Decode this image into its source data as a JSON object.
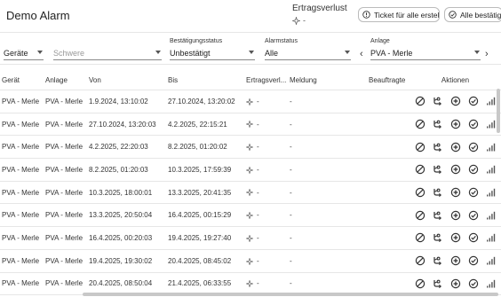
{
  "header": {
    "title": "Demo Alarm",
    "ertragsverlust_label": "Ertragsverlust",
    "ertragsverlust_value": "-",
    "ticket_button": "Ticket für alle erstellen",
    "confirm_all_button": "Alle bestätigen"
  },
  "filters": {
    "geraete": {
      "value": "Geräte"
    },
    "schwere": {
      "placeholder": "Schwere"
    },
    "bestaetigungsstatus": {
      "label": "Bestätigungsstatus",
      "value": "Unbestätigt"
    },
    "alarmstatus": {
      "label": "Alarmstatus",
      "value": "Alle"
    },
    "anlage": {
      "label": "Anlage",
      "value": "PVA - Merle",
      "prev": "‹",
      "next": "›"
    }
  },
  "table": {
    "columns": {
      "geraet": "Gerät",
      "anlage": "Anlage",
      "von": "Von",
      "bis": "Bis",
      "ertragsverlust": "Ertragsverl...",
      "meldung": "Meldung",
      "beauftragte": "Beauftragte",
      "aktionen": "Aktionen"
    },
    "rows": [
      {
        "geraet": "PVA - Merle",
        "anlage": "PVA - Merle",
        "von": "1.9.2024, 13:10:02",
        "bis": "27.10.2024, 13:20:02",
        "ertragsverlust": "-",
        "meldung": "-"
      },
      {
        "geraet": "PVA - Merle",
        "anlage": "PVA - Merle",
        "von": "27.10.2024, 13:20:03",
        "bis": "4.2.2025, 22:15:21",
        "ertragsverlust": "-",
        "meldung": "-"
      },
      {
        "geraet": "PVA - Merle",
        "anlage": "PVA - Merle",
        "von": "4.2.2025, 22:20:03",
        "bis": "8.2.2025, 01:20:02",
        "ertragsverlust": "-",
        "meldung": "-"
      },
      {
        "geraet": "PVA - Merle",
        "anlage": "PVA - Merle",
        "von": "8.2.2025, 01:20:03",
        "bis": "10.3.2025, 17:59:39",
        "ertragsverlust": "-",
        "meldung": "-"
      },
      {
        "geraet": "PVA - Merle",
        "anlage": "PVA - Merle",
        "von": "10.3.2025, 18:00:01",
        "bis": "13.3.2025, 20:41:35",
        "ertragsverlust": "-",
        "meldung": "-"
      },
      {
        "geraet": "PVA - Merle",
        "anlage": "PVA - Merle",
        "von": "13.3.2025, 20:50:04",
        "bis": "16.4.2025, 00:15:29",
        "ertragsverlust": "-",
        "meldung": "-"
      },
      {
        "geraet": "PVA - Merle",
        "anlage": "PVA - Merle",
        "von": "16.4.2025, 00:20:03",
        "bis": "19.4.2025, 19:27:40",
        "ertragsverlust": "-",
        "meldung": "-"
      },
      {
        "geraet": "PVA - Merle",
        "anlage": "PVA - Merle",
        "von": "19.4.2025, 19:30:02",
        "bis": "20.4.2025, 08:45:02",
        "ertragsverlust": "-",
        "meldung": "-"
      },
      {
        "geraet": "PVA - Merle",
        "anlage": "PVA - Merle",
        "von": "20.4.2025, 08:50:04",
        "bis": "21.4.2025, 06:33:55",
        "ertragsverlust": "-",
        "meldung": "-"
      }
    ],
    "row_actions": [
      "ignore-icon",
      "assign-icon",
      "add-ticket-icon",
      "confirm-icon",
      "signal-icon"
    ]
  }
}
